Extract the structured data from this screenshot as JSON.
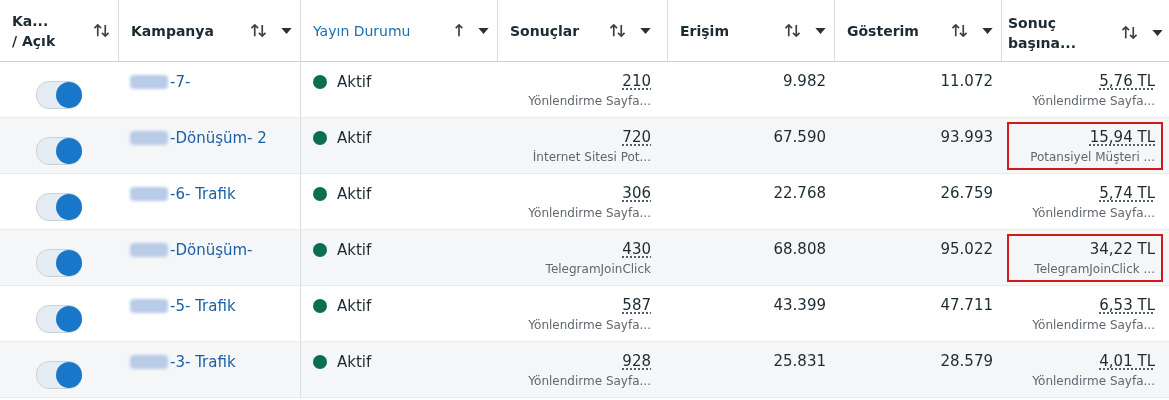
{
  "columns": [
    {
      "label": "Ka... / Açık",
      "kind": "sortable",
      "menu": false,
      "selected": false
    },
    {
      "label": "Kampanya",
      "kind": "sortable",
      "menu": true,
      "selected": false
    },
    {
      "label": "Yayın Durumu",
      "kind": "ascending",
      "menu": true,
      "selected": true
    },
    {
      "label": "Sonuçlar",
      "kind": "sortable",
      "menu": true,
      "selected": false
    },
    {
      "label": "Erişim",
      "kind": "sortable",
      "menu": true,
      "selected": false
    },
    {
      "label": "Gösterim",
      "kind": "sortable",
      "menu": true,
      "selected": false
    },
    {
      "label": "Sonuç başına...",
      "kind": "sortable",
      "menu": true,
      "selected": false
    }
  ],
  "rows": [
    {
      "on": true,
      "campaign": "-7-",
      "status": "Aktif",
      "color": "#0a6e4f",
      "results": "210",
      "results_type": "Yönlendirme Sayfa...",
      "reach": "9.982",
      "impressions": "11.072",
      "cost": "5,76 TL",
      "cost_dotted": true,
      "cost_type": "Yönlendirme Sayfa...",
      "highlighted": false
    },
    {
      "on": true,
      "campaign": "-Dönüşüm- 2",
      "status": "Aktif",
      "color": "#0a6e4f",
      "results": "720",
      "results_type": "İnternet Sitesi Pot...",
      "reach": "67.590",
      "impressions": "93.993",
      "cost": "15,94 TL",
      "cost_dotted": true,
      "cost_type": "Potansiyel Müşteri ...",
      "highlighted": true
    },
    {
      "on": true,
      "campaign": "-6- Trafik",
      "status": "Aktif",
      "color": "#0a6e4f",
      "results": "306",
      "results_type": "Yönlendirme Sayfa...",
      "reach": "22.768",
      "impressions": "26.759",
      "cost": "5,74 TL",
      "cost_dotted": true,
      "cost_type": "Yönlendirme Sayfa...",
      "highlighted": false
    },
    {
      "on": true,
      "campaign": "-Dönüşüm-",
      "status": "Aktif",
      "color": "#0a6e4f",
      "results": "430",
      "results_type": "TelegramJoinClick",
      "reach": "68.808",
      "impressions": "95.022",
      "cost": "34,22 TL",
      "cost_dotted": false,
      "cost_type": "TelegramJoinClick ...",
      "highlighted": true
    },
    {
      "on": true,
      "campaign": "-5- Trafik",
      "status": "Aktif",
      "color": "#0a6e4f",
      "results": "587",
      "results_type": "Yönlendirme Sayfa...",
      "reach": "43.399",
      "impressions": "47.711",
      "cost": "6,53 TL",
      "cost_dotted": true,
      "cost_type": "Yönlendirme Sayfa...",
      "highlighted": false
    },
    {
      "on": true,
      "campaign": "-3- Trafik",
      "status": "Aktif",
      "color": "#0a6e4f",
      "results": "928",
      "results_type": "Yönlendirme Sayfa...",
      "reach": "25.831",
      "impressions": "28.579",
      "cost": "4,01 TL",
      "cost_dotted": true,
      "cost_type": "Yönlendirme Sayfa...",
      "highlighted": false
    }
  ]
}
